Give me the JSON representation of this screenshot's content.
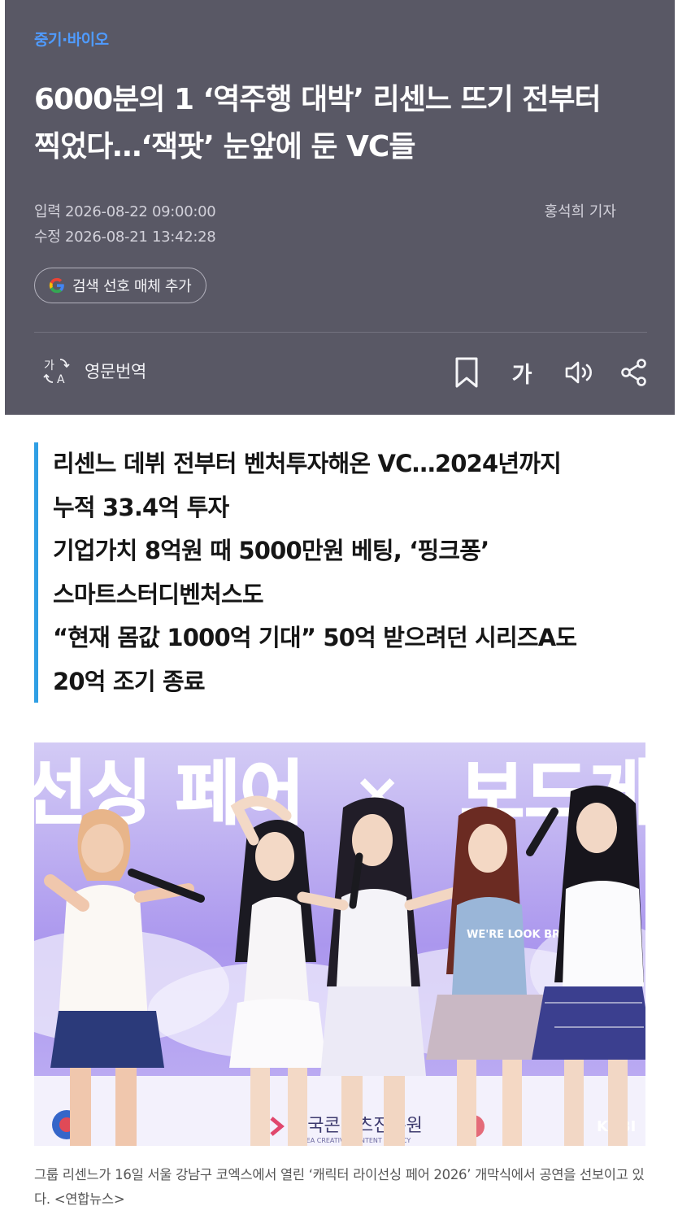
{
  "header": {
    "section": "중기·바이오",
    "headline_line1": "6000분의 1 ‘역주행 대박’ 리센느 뜨기 전부터",
    "headline_line2": "찍었다…‘잭팟’ 눈앞에 둔 VC들",
    "input_time": "입력 2026-08-22 09:00:00",
    "edit_time": "수정 2026-08-21 13:42:28",
    "reporter": "홍석희 기자",
    "google_button": "검색 선호 매체 추가",
    "translate_label": "영문번역",
    "font_button": "가"
  },
  "summary": [
    "리센느 데뷔 전부터 벤처투자해온 VC…2024년까지",
    "누적 33.4억 투자",
    "기업가치 8억원 때 5000만원 베팅, ‘핑크퐁’",
    "스마트스터디벤처스도",
    "“현재 몸값 1000억 기대” 50억 받으려던 시리즈A도",
    "20억 조기 종료"
  ],
  "photo": {
    "banner_left": "선싱 페어",
    "banner_x": "×",
    "banner_right": "보드게",
    "sponsor": "한국콘텐츠진흥원",
    "sponsor_sub": "KOREA CREATIVE CONTENT AGENCY",
    "shirt_text": "WE'RE LOOK BR",
    "corner_logo": "KABI"
  },
  "caption": "그룹 리센느가 16일 서울 강남구 코엑스에서 열린 ‘캐릭터 라이선싱 페어 2026’ 개막식에서 공연을 선보이고 있다. <연합뉴스>",
  "colors": {
    "header_bg": "#595865",
    "section_link": "#4f9bff",
    "summary_bar": "#2f9fe4",
    "stage_purple": "#a892ec"
  }
}
